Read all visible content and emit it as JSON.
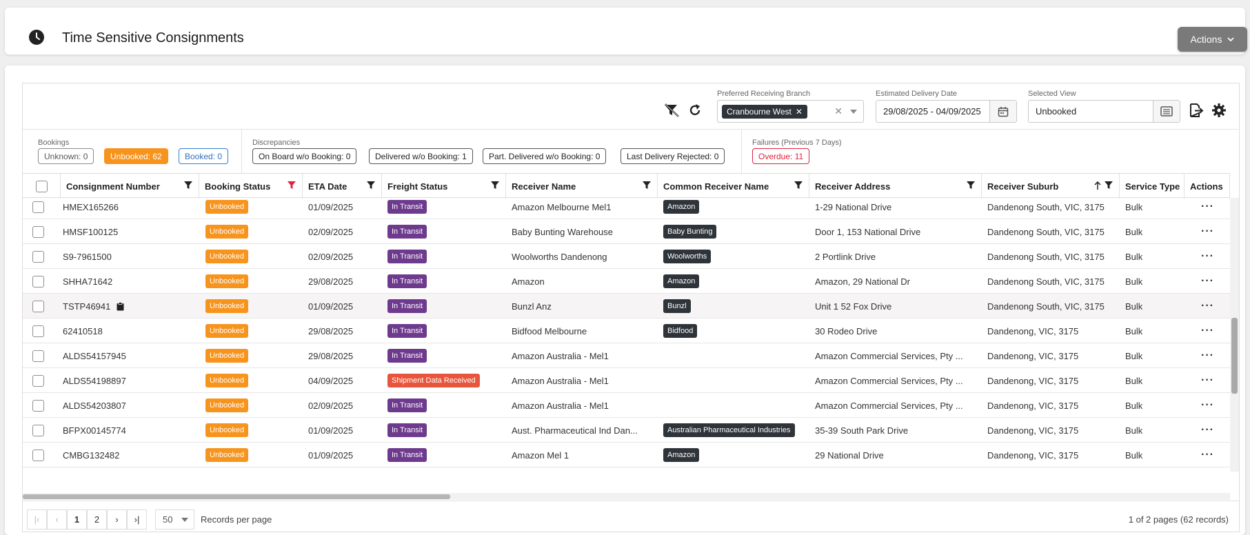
{
  "header": {
    "title": "Time Sensitive Consignments",
    "actions_label": "Actions"
  },
  "toolbar": {
    "branch_label": "Preferred Receiving Branch",
    "branch_chip": "Cranbourne West",
    "delivery_label": "Estimated Delivery Date",
    "delivery_value": "29/08/2025 - 04/09/2025",
    "view_label": "Selected View",
    "view_value": "Unbooked"
  },
  "filters": {
    "bookings_label": "Bookings",
    "bookings": [
      "Unknown: 0",
      "Unbooked: 62",
      "Booked: 0"
    ],
    "discrepancies_label": "Discrepancies",
    "discrepancies": [
      "On Board w/o Booking: 0",
      "Delivered w/o Booking: 1",
      "Part. Delivered w/o Booking: 0",
      "Last Delivery Rejected: 0"
    ],
    "failures_label": "Failures (Previous 7 Days)",
    "failures": [
      "Overdue: 11"
    ]
  },
  "columns": [
    "Consignment Number",
    "Booking Status",
    "ETA Date",
    "Freight Status",
    "Receiver Name",
    "Common Receiver Name",
    "Receiver Address",
    "Receiver Suburb",
    "Service Type",
    "Actions"
  ],
  "rows": [
    {
      "cn": "HMEX165266",
      "bs": "Unbooked",
      "eta": "01/09/2025",
      "fs": "In Transit",
      "rn": "Amazon Melbourne Mel1",
      "crn": "Amazon",
      "addr": "1-29 National Drive",
      "sub": "Dandenong South, VIC, 3175",
      "st": "Bulk"
    },
    {
      "cn": "HMSF100125",
      "bs": "Unbooked",
      "eta": "02/09/2025",
      "fs": "In Transit",
      "rn": "Baby Bunting Warehouse",
      "crn": "Baby Bunting",
      "addr": "Door 1, 153 National Drive",
      "sub": "Dandenong South, VIC, 3175",
      "st": "Bulk"
    },
    {
      "cn": "S9-7961500",
      "bs": "Unbooked",
      "eta": "02/09/2025",
      "fs": "In Transit",
      "rn": "Woolworths Dandenong",
      "crn": "Woolworths",
      "addr": "2 Portlink Drive",
      "sub": "Dandenong South, VIC, 3175",
      "st": "Bulk"
    },
    {
      "cn": "SHHA71642",
      "bs": "Unbooked",
      "eta": "29/08/2025",
      "fs": "In Transit",
      "rn": "Amazon",
      "crn": "Amazon",
      "addr": "Amazon, 29 National Dr",
      "sub": "Dandenong South, VIC, 3175",
      "st": "Bulk"
    },
    {
      "cn": "TSTP46941",
      "bs": "Unbooked",
      "eta": "01/09/2025",
      "fs": "In Transit",
      "rn": "Bunzl Anz",
      "crn": "Bunzl",
      "addr": "Unit 1 52 Fox Drive",
      "sub": "Dandenong South, VIC, 3175",
      "st": "Bulk"
    },
    {
      "cn": "62410518",
      "bs": "Unbooked",
      "eta": "29/08/2025",
      "fs": "In Transit",
      "rn": "Bidfood Melbourne",
      "crn": "Bidfood",
      "addr": "30 Rodeo Drive",
      "sub": "Dandenong, VIC, 3175",
      "st": "Bulk"
    },
    {
      "cn": "ALDS54157945",
      "bs": "Unbooked",
      "eta": "29/08/2025",
      "fs": "In Transit",
      "rn": "Amazon Australia - Mel1",
      "crn": "",
      "addr": "Amazon Commercial Services, Pty ...",
      "sub": "Dandenong, VIC, 3175",
      "st": "Bulk"
    },
    {
      "cn": "ALDS54198897",
      "bs": "Unbooked",
      "eta": "04/09/2025",
      "fs": "Shipment Data Received",
      "rn": "Amazon Australia - Mel1",
      "crn": "",
      "addr": "Amazon Commercial Services, Pty ...",
      "sub": "Dandenong, VIC, 3175",
      "st": "Bulk"
    },
    {
      "cn": "ALDS54203807",
      "bs": "Unbooked",
      "eta": "02/09/2025",
      "fs": "In Transit",
      "rn": "Amazon Australia - Mel1",
      "crn": "",
      "addr": "Amazon Commercial Services, Pty ...",
      "sub": "Dandenong, VIC, 3175",
      "st": "Bulk"
    },
    {
      "cn": "BFPX00145774",
      "bs": "Unbooked",
      "eta": "01/09/2025",
      "fs": "In Transit",
      "rn": "Aust. Pharmaceutical Ind Dan...",
      "crn": "Australian Pharmaceutical Industries",
      "addr": "35-39 South Park Drive",
      "sub": "Dandenong, VIC, 3175",
      "st": "Bulk"
    },
    {
      "cn": "CMBG132482",
      "bs": "Unbooked",
      "eta": "01/09/2025",
      "fs": "In Transit",
      "rn": "Amazon Mel 1",
      "crn": "Amazon",
      "addr": "29 National Drive",
      "sub": "Dandenong, VIC, 3175",
      "st": "Bulk"
    }
  ],
  "pager": {
    "page1": "1",
    "page2": "2",
    "page_size": "50",
    "per_page_label": "Records per page",
    "summary": "1 of 2 pages (62 records)"
  }
}
